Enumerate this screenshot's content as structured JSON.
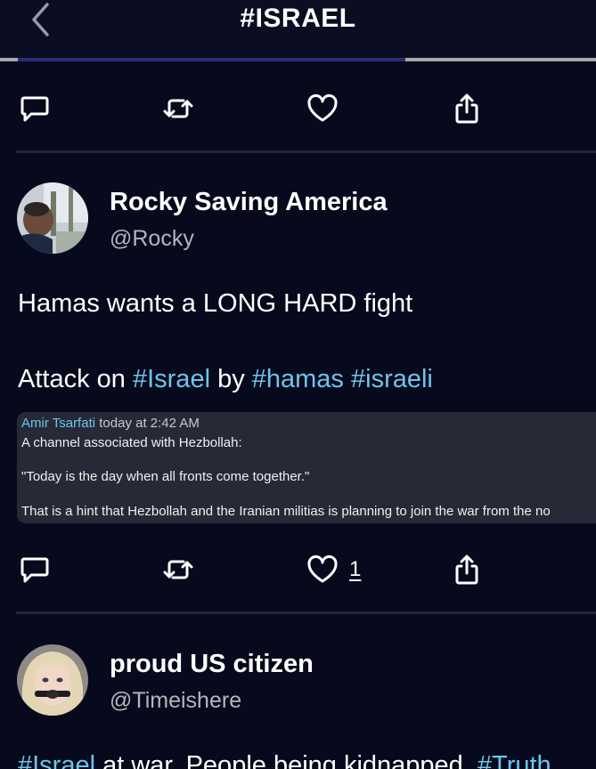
{
  "header": {
    "title": "#ISRAEL",
    "scroll_progress": 0.67
  },
  "posts": [
    {
      "display_name": "Rocky Saving America",
      "handle": "@Rocky",
      "text_line1": "Hamas wants a LONG HARD fight",
      "text_line2_prefix": "Attack on ",
      "text_line2_tag1": "#Israel",
      "text_line2_mid": " by ",
      "text_line2_tag2": "#hamas",
      "text_line2_space": " ",
      "text_line2_tag3": "#israeli",
      "quote": {
        "author": "Amir Tsarfati",
        "time": "today at 2:42 AM",
        "line1": "A channel associated with Hezbollah:",
        "line2": "\"Today is the day when all fronts come together.\"",
        "line3": "That is a hint that Hezbollah and the Iranian militias is planning to join the war from the no"
      },
      "like_count": "1"
    },
    {
      "display_name": "proud US citizen",
      "handle": "@Timeishere",
      "text_tag1": "#Israel",
      "text_mid": " at war. People being kidnapped. ",
      "text_tag2": "#Truth"
    }
  ],
  "icons": [
    "back-chevron-icon",
    "reply-icon",
    "repost-icon",
    "like-icon",
    "share-icon"
  ],
  "colors": {
    "background": "#070a1c",
    "hashtag": "#6cc5ec",
    "handle": "#b5b5bd",
    "quote_bg": "#272a36"
  }
}
